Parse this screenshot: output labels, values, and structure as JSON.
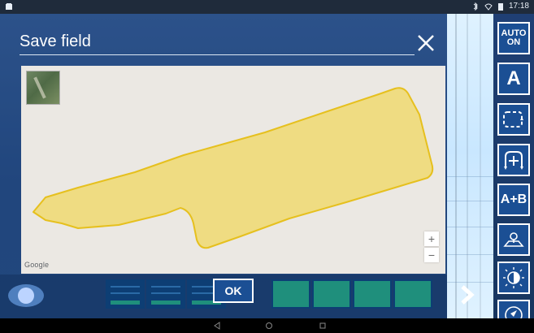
{
  "status_bar": {
    "time": "17:18"
  },
  "dialog": {
    "title": "Save field",
    "ok_label": "OK"
  },
  "map": {
    "attribution": "Google",
    "zoom_in_label": "+",
    "zoom_out_label": "−"
  },
  "toolbar": {
    "auto_label": "AUTO ON",
    "a_label": "A",
    "ab_label": "A+B"
  },
  "colors": {
    "boundary_fill": "#efdc82",
    "boundary_stroke": "#e6c01e",
    "accent_blue": "#1b4f94"
  }
}
